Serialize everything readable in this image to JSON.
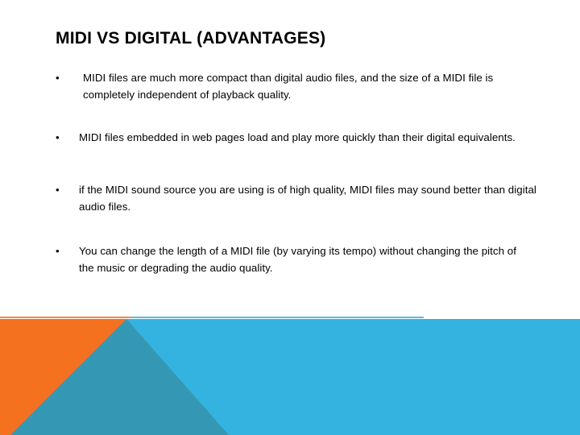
{
  "slide": {
    "title": "MIDI VS DIGITAL (ADVANTAGES)",
    "bullet_marker": "•",
    "bullets": [
      "MIDI files are much more compact than digital audio files, and the size of a MIDI file is completely independent of playback quality.",
      "MIDI files embedded in web pages load and play more quickly than their digital equivalents.",
      "if the MIDI sound source you are using is of high quality, MIDI files may sound better than digital audio files.",
      "You can change the length of a MIDI file (by varying its tempo) without changing the pitch of the music or degrading the audio quality."
    ]
  },
  "colors": {
    "background": "#ffffff",
    "text": "#000000",
    "accent_orange": "#f4711f",
    "accent_teal": "#3498b4",
    "accent_blue": "#35b3e0"
  }
}
